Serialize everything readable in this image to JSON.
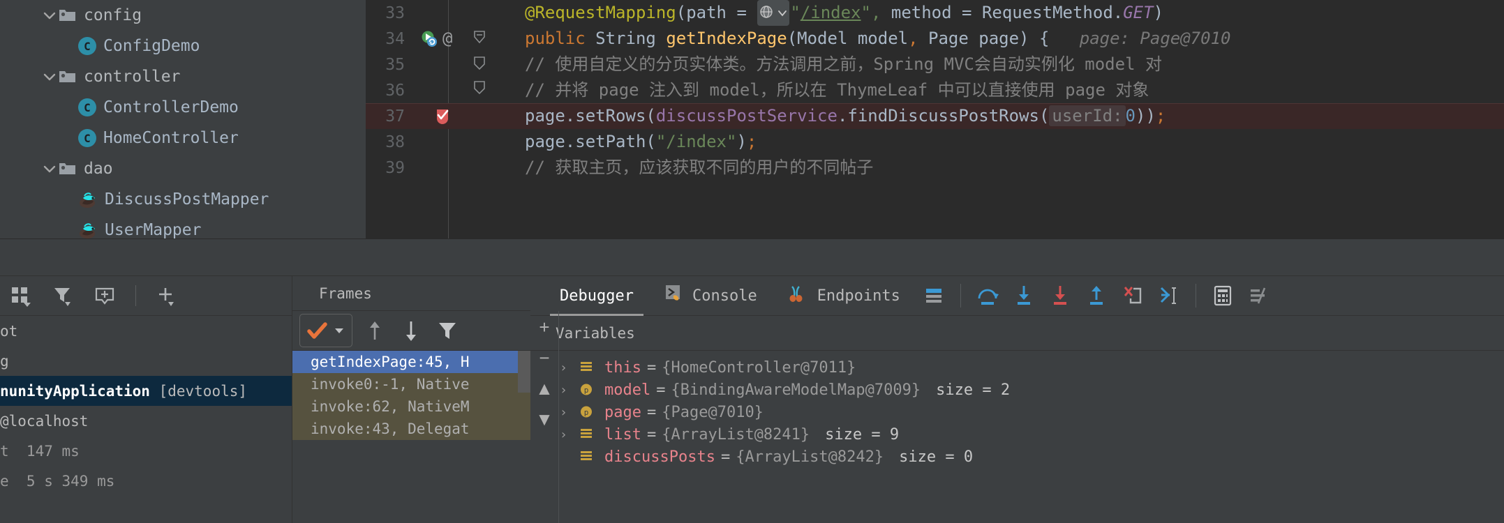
{
  "project_tree": {
    "items": [
      {
        "label": "config",
        "type": "folder",
        "depth": 0,
        "expanded": true,
        "icon": "folder-icon"
      },
      {
        "label": "ConfigDemo",
        "type": "class",
        "depth": 1,
        "expanded": false,
        "icon": "java-class-icon"
      },
      {
        "label": "controller",
        "type": "folder",
        "depth": 0,
        "expanded": true,
        "icon": "folder-icon"
      },
      {
        "label": "ControllerDemo",
        "type": "class",
        "depth": 1,
        "expanded": false,
        "icon": "java-class-icon"
      },
      {
        "label": "HomeController",
        "type": "class",
        "depth": 1,
        "expanded": false,
        "icon": "java-class-icon"
      },
      {
        "label": "dao",
        "type": "folder",
        "depth": 0,
        "expanded": true,
        "icon": "folder-icon"
      },
      {
        "label": "DiscussPostMapper",
        "type": "mapper",
        "depth": 1,
        "expanded": false,
        "icon": "mybatis-mapper-icon"
      },
      {
        "label": "UserMapper",
        "type": "mapper",
        "depth": 1,
        "expanded": false,
        "icon": "mybatis-mapper-icon"
      }
    ]
  },
  "editor": {
    "lines": [
      {
        "number": "33",
        "highlighted": false,
        "gutter": [],
        "segments": [
          {
            "t": "@RequestMapping",
            "c": "ann"
          },
          {
            "t": "(path ",
            "c": "plain"
          },
          {
            "t": "= ",
            "c": "plain"
          },
          {
            "t": "globe-chip",
            "c": "chip"
          },
          {
            "t": "\"",
            "c": "str"
          },
          {
            "t": "/index",
            "c": "str-u"
          },
          {
            "t": "\", ",
            "c": "str"
          },
          {
            "t": "method ",
            "c": "plain"
          },
          {
            "t": "= ",
            "c": "plain"
          },
          {
            "t": "RequestMethod.",
            "c": "plain"
          },
          {
            "t": "GET",
            "c": "ital"
          },
          {
            "t": ")",
            "c": "plain"
          }
        ]
      },
      {
        "number": "34",
        "highlighted": false,
        "gutter": [
          "run-method-icon",
          "at-icon",
          "fold-icon"
        ],
        "segments": [
          {
            "t": "public ",
            "c": "kw"
          },
          {
            "t": "String ",
            "c": "plain"
          },
          {
            "t": "getIndexPage",
            "c": "meth"
          },
          {
            "t": "(Model model",
            "c": "plain"
          },
          {
            "t": ", ",
            "c": "comma"
          },
          {
            "t": "Page page) {",
            "c": "plain"
          },
          {
            "t": "   page: Page@7010",
            "c": "hint"
          }
        ]
      },
      {
        "number": "35",
        "highlighted": false,
        "gutter": [
          "fold-icon"
        ],
        "segments": [
          {
            "t": "// 使用自定义的分页实体类。方法调用之前，Spring MVC会自动实例化 model 对",
            "c": "cmt"
          }
        ]
      },
      {
        "number": "36",
        "highlighted": false,
        "gutter": [
          "fold-icon"
        ],
        "segments": [
          {
            "t": "// 并将 page 注入到 model，所以在 ThymeLeaf 中可以直接使用 page 对象",
            "c": "cmt"
          }
        ]
      },
      {
        "number": "37",
        "highlighted": true,
        "gutter": [
          "breakpoint-verified-icon"
        ],
        "segments": [
          {
            "t": "page.",
            "c": "plain"
          },
          {
            "t": "setRows",
            "c": "plain"
          },
          {
            "t": "(",
            "c": "plain"
          },
          {
            "t": "discussPostService",
            "c": "fld"
          },
          {
            "t": ".findDiscussPostRows(",
            "c": "plain"
          },
          {
            "t": " userId: ",
            "c": "paramhint"
          },
          {
            "t": "0",
            "c": "num"
          },
          {
            "t": "))",
            "c": "plain"
          },
          {
            "t": ";",
            "c": "comma"
          }
        ]
      },
      {
        "number": "38",
        "highlighted": false,
        "gutter": [],
        "segments": [
          {
            "t": "page.",
            "c": "plain"
          },
          {
            "t": "setPath(",
            "c": "plain"
          },
          {
            "t": "\"/index\"",
            "c": "str"
          },
          {
            "t": ")",
            "c": "plain"
          },
          {
            "t": ";",
            "c": "comma"
          }
        ]
      },
      {
        "number": "39",
        "highlighted": false,
        "gutter": [],
        "segments": [
          {
            "t": "// 获取主页，应该获取不同的用户的不同帖子",
            "c": "cmt"
          }
        ]
      }
    ]
  },
  "divider": {
    "target_icon": "locate-target-icon"
  },
  "services": {
    "toolbar": [
      {
        "icon": "group-by-icon",
        "name": "group-by-button"
      },
      {
        "icon": "filter-icon",
        "name": "filter-button"
      },
      {
        "icon": "add-frame-icon",
        "name": "add-configuration-button"
      },
      {
        "icon": "plus-icon",
        "name": "add-button"
      }
    ],
    "rows": [
      {
        "text": "ot",
        "selected": false,
        "style": "plain"
      },
      {
        "text": "g",
        "selected": false,
        "style": "plain"
      },
      {
        "text": "nunityApplication [devtools]",
        "selected": true,
        "style": "bold"
      },
      {
        "text": "@localhost",
        "selected": false,
        "style": "plain"
      },
      {
        "text": "t  147 ms",
        "selected": false,
        "style": "muted"
      },
      {
        "text": "e  5 s 349 ms",
        "selected": false,
        "style": "muted"
      }
    ]
  },
  "frames": {
    "title": "Frames",
    "toolbar": {
      "thread_selector": "thread-dropdown",
      "up_button": "step-up-frame",
      "down_button": "step-down-frame",
      "filter_button": "filter-frames"
    },
    "rows": [
      {
        "text": "getIndexPage:45, H",
        "selected": true,
        "shaded": false
      },
      {
        "text": "invoke0:-1, Native",
        "selected": false,
        "shaded": true
      },
      {
        "text": "invoke:62, NativeM",
        "selected": false,
        "shaded": true
      },
      {
        "text": "invoke:43, Delegat",
        "selected": false,
        "shaded": true
      }
    ]
  },
  "debugger": {
    "tabs": [
      {
        "label": "Debugger",
        "icon": null,
        "active": true
      },
      {
        "label": "Console",
        "icon": "console-icon",
        "active": false
      },
      {
        "label": "Endpoints",
        "icon": "endpoints-icon",
        "active": false
      }
    ],
    "toolbar": [
      {
        "icon": "layout-settings-icon",
        "name": "layout-settings-button"
      },
      {
        "icon": "step-over-icon",
        "name": "step-over-button"
      },
      {
        "icon": "step-into-icon",
        "name": "step-into-button"
      },
      {
        "icon": "force-step-into-icon",
        "name": "force-step-into-button"
      },
      {
        "icon": "step-out-icon",
        "name": "step-out-button"
      },
      {
        "icon": "drop-frame-icon",
        "name": "drop-frame-button"
      },
      {
        "icon": "run-to-cursor-icon",
        "name": "run-to-cursor-button"
      },
      {
        "icon": "evaluate-expression-icon",
        "name": "evaluate-expression-button"
      },
      {
        "icon": "mute-breakpoints-icon",
        "name": "settings-button"
      }
    ],
    "variables_header": "Variables",
    "variables": [
      {
        "arrow": "›",
        "icon": "object-icon",
        "name": "this",
        "value": "{HomeController@7011}",
        "size": ""
      },
      {
        "arrow": "›",
        "icon": "parameter-icon",
        "name": "model",
        "value": "{BindingAwareModelMap@7009}",
        "size": "size = 2"
      },
      {
        "arrow": "›",
        "icon": "parameter-icon",
        "name": "page",
        "value": "{Page@7010}",
        "size": ""
      },
      {
        "arrow": "›",
        "icon": "object-icon",
        "name": "list",
        "value": "{ArrayList@8241}",
        "size": "size = 9"
      },
      {
        "arrow": "",
        "icon": "object-icon",
        "name": "discussPosts",
        "value": "{ArrayList@8242}",
        "size": "size = 0"
      }
    ]
  },
  "colors": {
    "editor_bg": "#2b2b2b",
    "panel_bg": "#3c3f41",
    "highlight_line": "#3a2727",
    "selection_blue": "#4b6eaf",
    "selection_dark_blue": "#0d293e",
    "frame_shade": "#56523f",
    "annotation_yellow": "#bbb529",
    "keyword_orange": "#cc7832",
    "string_green": "#6a8759",
    "method_gold": "#ffc66d",
    "field_purple": "#9876aa",
    "var_name_pink": "#e8838c",
    "comment_gray": "#808080",
    "class_icon_teal": "#2d8fa8"
  }
}
